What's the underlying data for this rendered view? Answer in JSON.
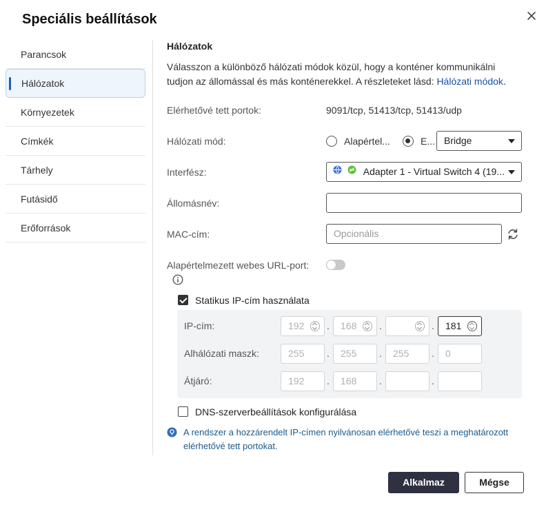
{
  "dialog": {
    "title": "Speciális beállítások"
  },
  "sidebar": {
    "items": [
      {
        "label": "Parancsok"
      },
      {
        "label": "Hálózatok"
      },
      {
        "label": "Környezetek"
      },
      {
        "label": "Címkék"
      },
      {
        "label": "Tárhely"
      },
      {
        "label": "Futásidő"
      },
      {
        "label": "Erőforrások"
      }
    ],
    "active": "Hálózatok"
  },
  "section": {
    "title": "Hálózatok",
    "description": "Válasszon a különböző hálózati módok közül, hogy a konténer kommunikálni tudjon az állomással és más konténerekkel. A részleteket lásd: ",
    "link": "Hálózati módok",
    "description_end": "."
  },
  "form": {
    "exposed_ports": {
      "label": "Elérhetővé tett portok:",
      "value": "9091/tcp, 51413/tcp, 51413/udp"
    },
    "network_mode": {
      "label": "Hálózati mód:",
      "option_default": "Alapértel...",
      "option_other": "E...",
      "selected_value": "Bridge"
    },
    "interface": {
      "label": "Interfész:",
      "value": "Adapter 1 - Virtual Switch 4 (19..."
    },
    "hostname": {
      "label": "Állomásnév:",
      "value": ""
    },
    "mac": {
      "label": "MAC-cím:",
      "placeholder": "Opcionális"
    },
    "default_web_port": {
      "label": "Alapértelmezett webes URL-port:",
      "enabled": false
    },
    "static_ip": {
      "label": "Statikus IP-cím használata",
      "checked": true
    },
    "ip": {
      "label": "IP-cím:",
      "octets": [
        "192",
        "168",
        "",
        "181"
      ]
    },
    "subnet": {
      "label": "Alhálózati maszk:",
      "octets": [
        "255",
        "255",
        "255",
        "0"
      ]
    },
    "gateway": {
      "label": "Átjáró:",
      "octets": [
        "192",
        "168",
        "",
        ""
      ]
    },
    "dns": {
      "label": "DNS-szerverbeállítások konfigurálása",
      "checked": false
    },
    "info": "A rendszer a hozzárendelt IP-címen nyilvánosan elérhetővé teszi a meghatározott elérhetővé tett portokat."
  },
  "buttons": {
    "apply": "Alkalmaz",
    "cancel": "Mégse"
  },
  "colors": {
    "accent": "#1a5fb4",
    "primary_button": "#2f3142",
    "link": "#1a4fa3",
    "info_text": "#1a5a8a"
  }
}
